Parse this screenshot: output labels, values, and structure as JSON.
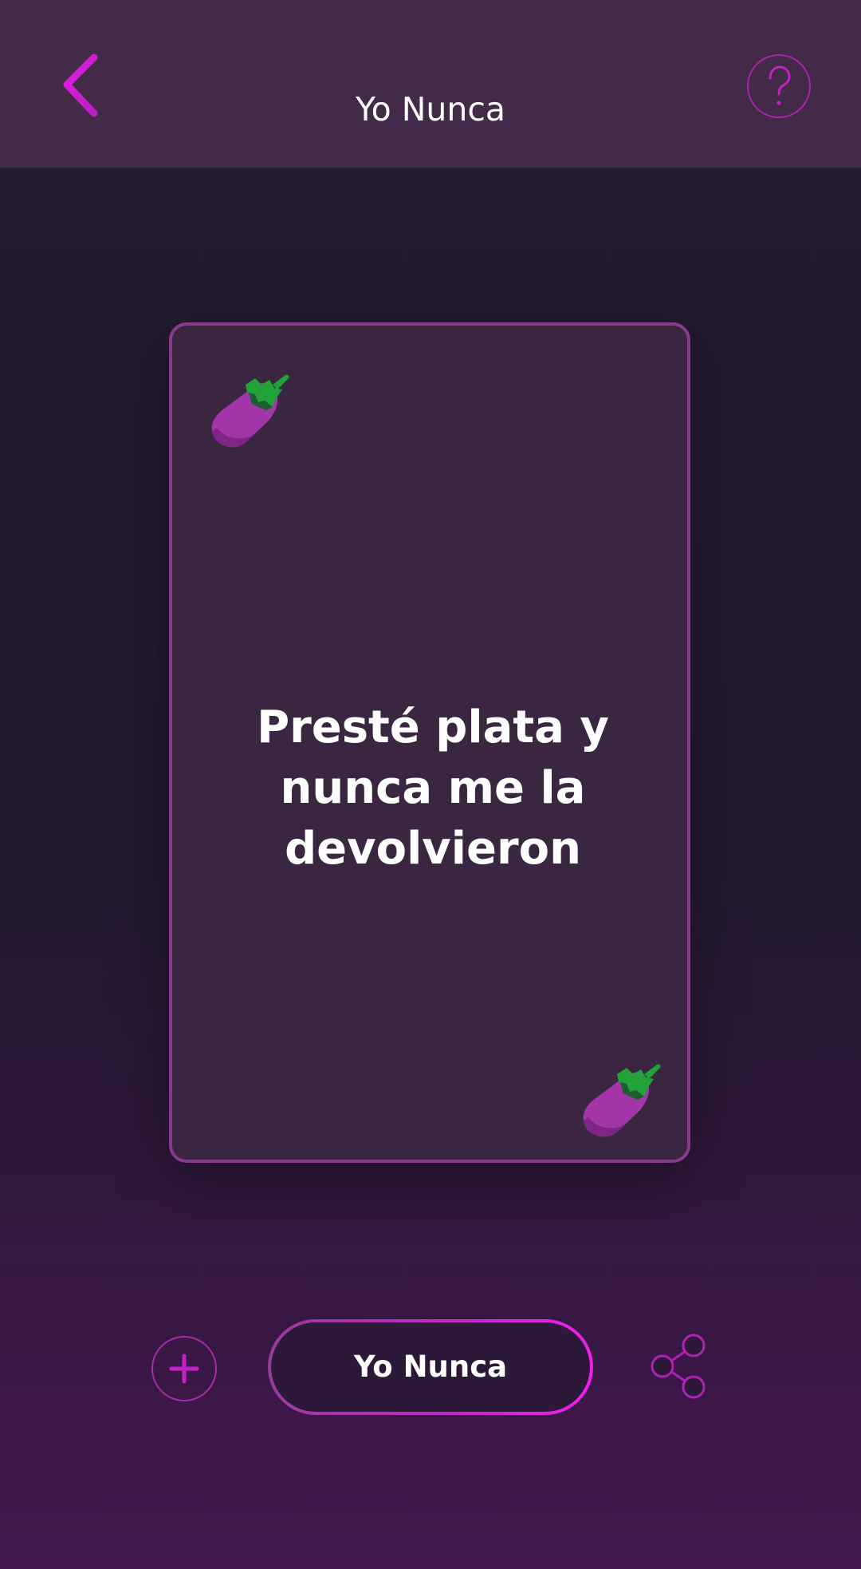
{
  "header": {
    "title": "Yo Nunca",
    "back_icon": "chevron-left-icon",
    "help_icon": "question-mark-icon"
  },
  "card": {
    "text": "Presté plata y nunca me la devolvieron",
    "corner_icon": "eggplant-icon"
  },
  "bottom_bar": {
    "add_icon": "plus-icon",
    "main_button_label": "Yo Nunca",
    "share_icon": "share-icon"
  },
  "colors": {
    "accent": "#d21fd6",
    "header_bg": "#432a49",
    "background": "#231c2f",
    "card_bg": "#3a2640",
    "card_border": "#8a3a8e"
  }
}
